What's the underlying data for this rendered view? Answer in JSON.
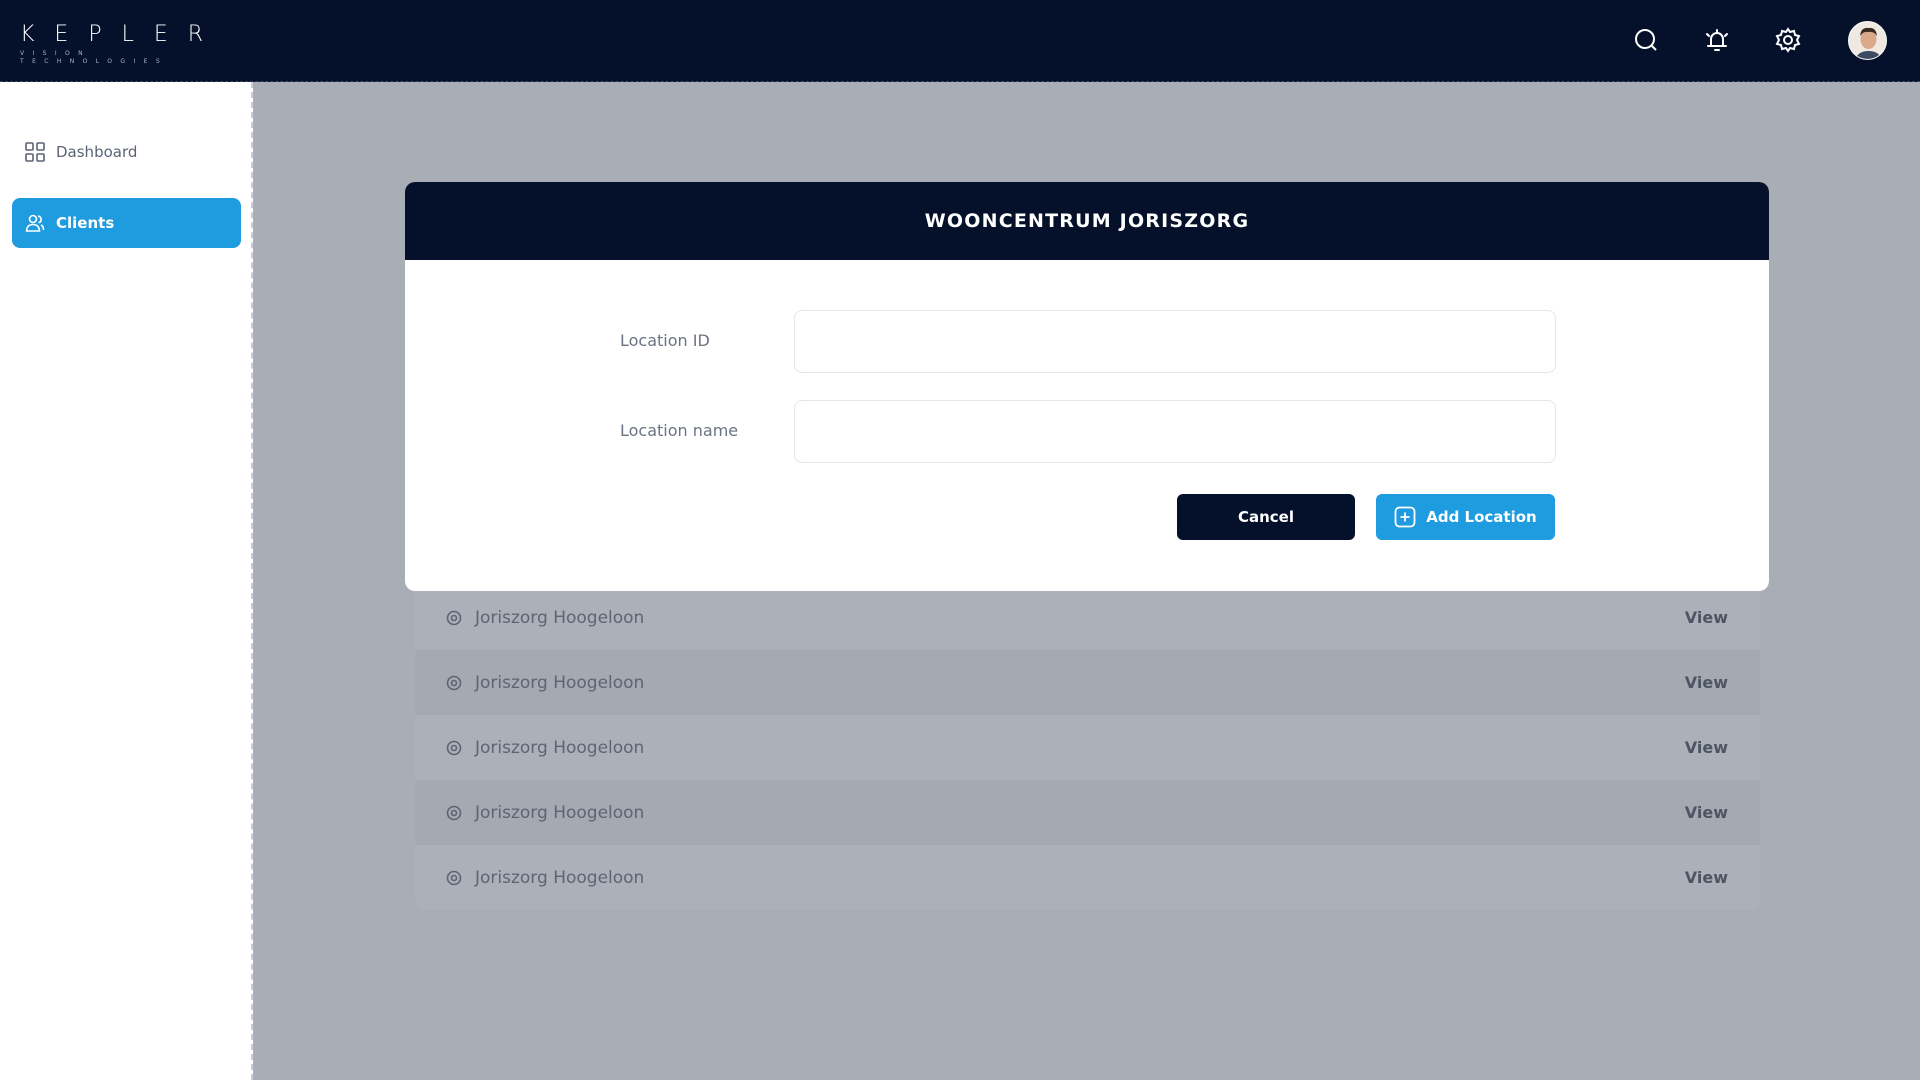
{
  "app": {
    "logo_text": "KEPLER",
    "logo_subtitle": "VISION TECHNOLOGIES"
  },
  "topbar": {
    "icons": [
      "search-icon",
      "bell-icon",
      "gear-icon",
      "avatar"
    ]
  },
  "sidebar": {
    "items": [
      {
        "label": "Dashboard",
        "icon": "grid-icon",
        "active": false
      },
      {
        "label": "Clients",
        "icon": "users-icon",
        "active": true
      }
    ]
  },
  "modal": {
    "title": "WOONCENTRUM JORISZORG",
    "fields": [
      {
        "label": "Location ID",
        "value": "",
        "placeholder": ""
      },
      {
        "label": "Location name",
        "value": "",
        "placeholder": ""
      }
    ],
    "cancel_label": "Cancel",
    "add_label": "Add Location"
  },
  "locations": {
    "rows": [
      {
        "name": "Joriszorg Hoogeloon",
        "action": "View"
      },
      {
        "name": "Joriszorg Hoogeloon",
        "action": "View"
      },
      {
        "name": "Joriszorg Hoogeloon",
        "action": "View"
      },
      {
        "name": "Joriszorg Hoogeloon",
        "action": "View"
      },
      {
        "name": "Joriszorg Hoogeloon",
        "action": "View"
      }
    ]
  },
  "colors": {
    "navy": "#05102a",
    "accent": "#1f9be0",
    "overlay": "#a9adb6"
  }
}
